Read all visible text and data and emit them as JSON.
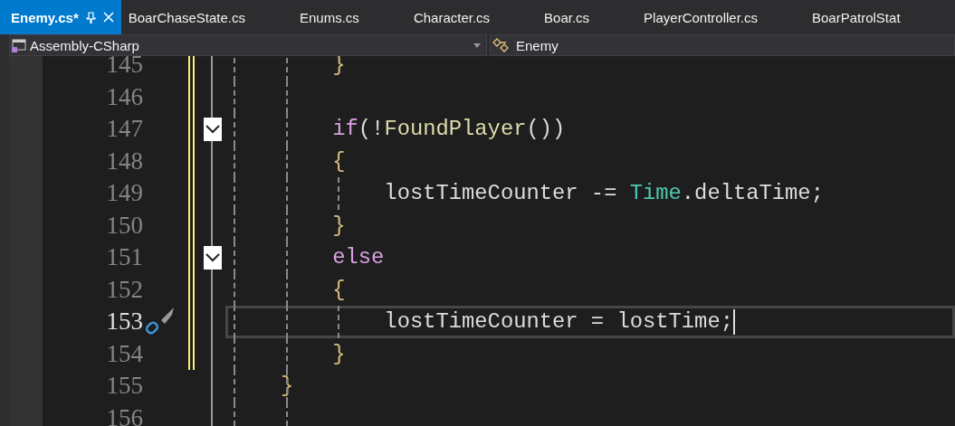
{
  "tabs": [
    {
      "label": "Enemy.cs*",
      "selected": true
    },
    {
      "label": "BoarChaseState.cs",
      "selected": false
    },
    {
      "label": "Enums.cs",
      "selected": false
    },
    {
      "label": "Character.cs",
      "selected": false
    },
    {
      "label": "Boar.cs",
      "selected": false
    },
    {
      "label": "PlayerController.cs",
      "selected": false
    },
    {
      "label": "BoarPatrolStat",
      "selected": false
    }
  ],
  "navigation": {
    "project": "Assembly-CSharp",
    "member": "Enemy"
  },
  "lines": [
    {
      "number": "145",
      "modified": true,
      "foldable": false,
      "current": false,
      "tokens": [
        {
          "kind": "brace",
          "text": "        }"
        }
      ]
    },
    {
      "number": "146",
      "modified": true,
      "foldable": false,
      "current": false
    },
    {
      "number": "147",
      "modified": true,
      "foldable": true,
      "current": false,
      "tokens": [
        {
          "kind": "keyword",
          "text": "        if"
        },
        {
          "kind": "punct",
          "text": "(!"
        },
        {
          "kind": "method",
          "text": "FoundPlayer"
        },
        {
          "kind": "punct",
          "text": "())"
        }
      ]
    },
    {
      "number": "148",
      "modified": true,
      "foldable": false,
      "current": false,
      "tokens": [
        {
          "kind": "brace",
          "text": "        {"
        }
      ]
    },
    {
      "number": "149",
      "modified": true,
      "foldable": false,
      "current": false,
      "tokens": [
        {
          "kind": "plain",
          "text": "            lostTimeCounter -= "
        },
        {
          "kind": "type",
          "text": "Time"
        },
        {
          "kind": "plain",
          "text": ".deltaTime;"
        }
      ]
    },
    {
      "number": "150",
      "modified": true,
      "foldable": false,
      "current": false,
      "tokens": [
        {
          "kind": "brace",
          "text": "        }"
        }
      ]
    },
    {
      "number": "151",
      "modified": true,
      "foldable": true,
      "current": false,
      "tokens": [
        {
          "kind": "keyword",
          "text": "        else"
        }
      ]
    },
    {
      "number": "152",
      "modified": true,
      "foldable": false,
      "current": false,
      "tokens": [
        {
          "kind": "brace",
          "text": "        {"
        }
      ]
    },
    {
      "number": "153",
      "modified": true,
      "foldable": false,
      "current": true,
      "tokens": [
        {
          "kind": "plain",
          "text": "            lostTimeCounter = lostTime;"
        }
      ]
    },
    {
      "number": "154",
      "modified": true,
      "foldable": false,
      "current": false,
      "tokens": [
        {
          "kind": "brace",
          "text": "        }"
        }
      ]
    },
    {
      "number": "155",
      "modified": false,
      "foldable": false,
      "current": false,
      "tokens": [
        {
          "kind": "brace",
          "text": "    }"
        }
      ]
    },
    {
      "number": "156",
      "modified": false,
      "foldable": false,
      "current": false
    }
  ]
}
